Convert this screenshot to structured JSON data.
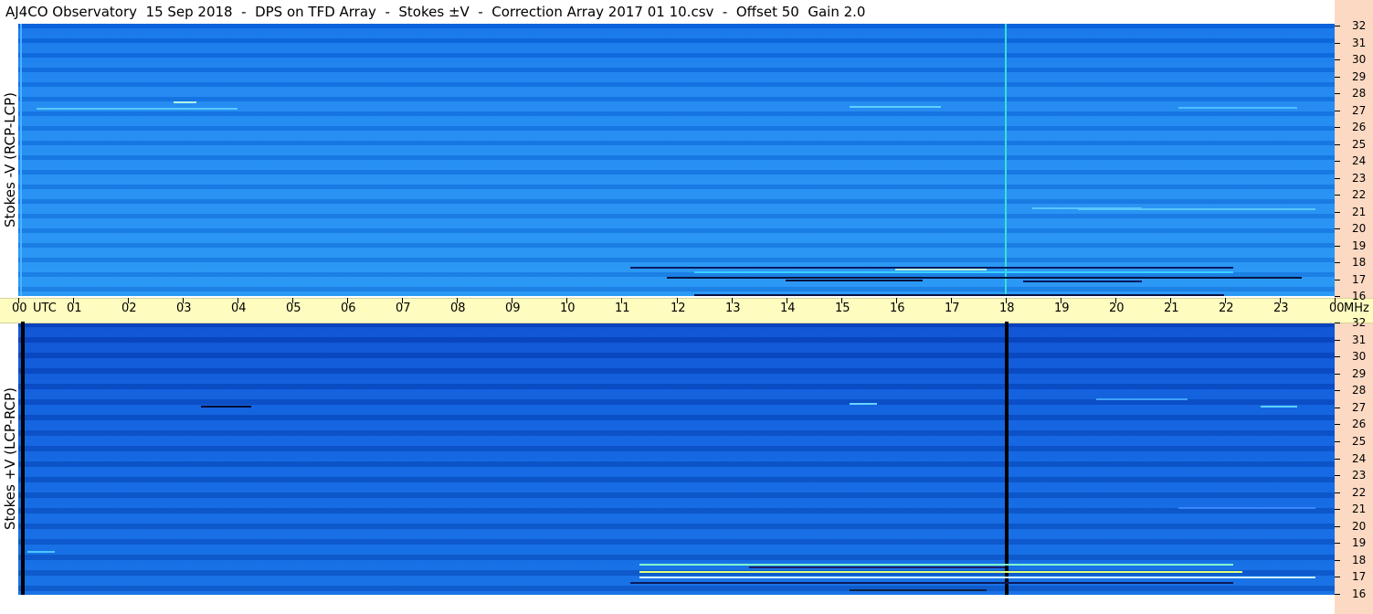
{
  "title": "AJ4CO Observatory  15 Sep 2018  -  DPS on TFD Array  -  Stokes ±V  -  Correction Array 2017 01 10.csv  -  Offset 50  Gain 2.0",
  "panels": {
    "top": {
      "label": "Stokes -V (RCP-LCP)"
    },
    "bottom": {
      "label": "Stokes +V (LCP-RCP)"
    }
  },
  "time_axis": {
    "utc_label": "UTC",
    "unit_label": "MHz",
    "hours": [
      "00",
      "01",
      "02",
      "03",
      "04",
      "05",
      "06",
      "07",
      "08",
      "09",
      "10",
      "11",
      "12",
      "13",
      "14",
      "15",
      "16",
      "17",
      "18",
      "19",
      "20",
      "21",
      "22",
      "23",
      "00"
    ]
  },
  "frequency_axis": {
    "ticks": [
      "32",
      "31",
      "30",
      "29",
      "28",
      "27",
      "26",
      "25",
      "24",
      "23",
      "22",
      "21",
      "20",
      "19",
      "18",
      "17",
      "16"
    ]
  },
  "colors": {
    "top_background": "#1a84f0",
    "bottom_background": "#0e5fdc",
    "time_axis_bg": "#fffcc0",
    "mhz_bg": "#fcd9c2",
    "top_marker": "#38e0d0",
    "bottom_marker": "#000000"
  }
}
